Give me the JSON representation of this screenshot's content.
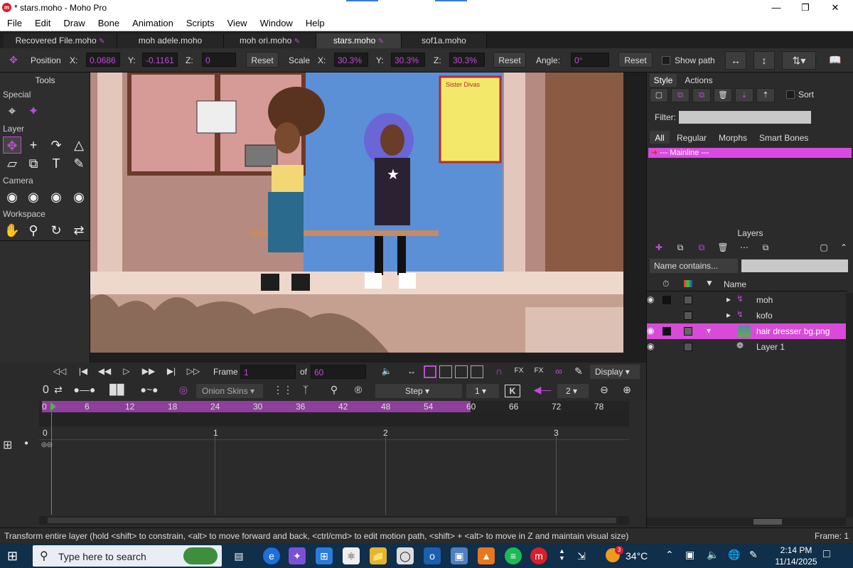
{
  "window": {
    "title": "* stars.moho - Moho Pro",
    "logo": "m",
    "min": "—",
    "max": "❐",
    "close": "✕"
  },
  "menu": [
    "File",
    "Edit",
    "Draw",
    "Bone",
    "Animation",
    "Scripts",
    "View",
    "Window",
    "Help"
  ],
  "tabs": [
    "Recovered File.moho",
    "moh adele.moho",
    "moh ori.moho",
    "stars.moho",
    "sof1a.moho"
  ],
  "tool_options": {
    "position_label": "Position",
    "x_label": "X:",
    "x": "0.0686",
    "y_label": "Y:",
    "y": "-0.1161",
    "z_label": "Z:",
    "z": "0",
    "reset": "Reset",
    "scale_label": "Scale",
    "sx_label": "X:",
    "sx": "30.3%",
    "sy_label": "Y:",
    "sy": "30.3%",
    "sz_label": "Z:",
    "sz": "30.3%",
    "angle_label": "Angle:",
    "angle": "0°",
    "show_path": "Show path"
  },
  "tools": {
    "title": "Tools",
    "special": "Special",
    "layer": "Layer",
    "camera": "Camera",
    "workspace": "Workspace"
  },
  "canvas": {
    "poster_title": "Sister Divas"
  },
  "playback": {
    "frame_label": "Frame",
    "frame": "1",
    "of_label": "of",
    "total": "60",
    "display": "Display"
  },
  "timeline": {
    "onion": "Onion Skins",
    "step": "Step",
    "step_val": "1",
    "key": "K",
    "num2": "2",
    "zero": "0",
    "ruler": [
      "0",
      "6",
      "12",
      "18",
      "24",
      "30",
      "36",
      "42",
      "48",
      "54",
      "60",
      "66",
      "72",
      "78"
    ],
    "seconds": [
      "0",
      "1",
      "2",
      "3"
    ]
  },
  "right": {
    "style_tab": "Style",
    "actions_tab": "Actions",
    "sort": "Sort",
    "filter_label": "Filter:",
    "filter_tabs": [
      "All",
      "Regular",
      "Morphs",
      "Smart Bones"
    ],
    "mainline": "--- Mainline ---",
    "layers_title": "Layers",
    "name_filter": "Name contains...",
    "name_col": "Name",
    "layers": [
      "moh",
      "kofo",
      "hair dresser bg.png",
      "Layer 1"
    ]
  },
  "status": {
    "hint": "Transform entire layer (hold <shift> to constrain, <alt> to move forward and back, <ctrl/cmd> to edit motion path, <shift> + <alt> to move in Z and maintain visual size)",
    "frame": "Frame: 1"
  },
  "taskbar": {
    "search": "Type here to search",
    "temp": "34°C",
    "time": "2:14 PM",
    "date": "11/14/2025",
    "badge": "3"
  },
  "colors": {
    "accent": "#c04bd8",
    "selected_row": "#d84bd8",
    "mainline": "#d94be0"
  }
}
